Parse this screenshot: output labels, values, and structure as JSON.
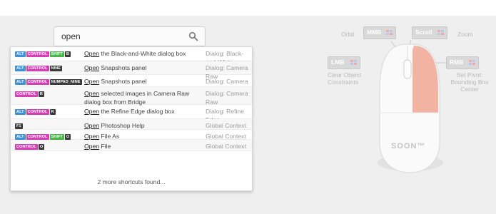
{
  "search": {
    "value": "open",
    "icon": "search-icon"
  },
  "results": [
    {
      "keys": [
        {
          "label": "ALT",
          "type": "alt"
        },
        {
          "label": "CONTROL",
          "type": "control"
        },
        {
          "label": "SHIFT",
          "type": "shift"
        },
        {
          "label": "B",
          "type": "plain"
        }
      ],
      "highlight": "Open",
      "text": " the Black-and-White dialog box",
      "context": "Dialog: Black-and-White"
    },
    {
      "keys": [
        {
          "label": "ALT",
          "type": "alt"
        },
        {
          "label": "CONTROL",
          "type": "control"
        },
        {
          "label": "NINE",
          "type": "plain"
        }
      ],
      "highlight": "Open",
      "text": " Snapshots panel",
      "context": "Dialog: Camera Raw"
    },
    {
      "keys": [
        {
          "label": "ALT",
          "type": "alt"
        },
        {
          "label": "CONTROL",
          "type": "control"
        },
        {
          "label": "NUMPAD_NINE",
          "type": "plain"
        }
      ],
      "highlight": "Open",
      "text": " Snapshots panel",
      "context": "Dialog: Camera Raw"
    },
    {
      "keys": [
        {
          "label": "CONTROL",
          "type": "control"
        },
        {
          "label": "R",
          "type": "plain"
        }
      ],
      "highlight": "Open",
      "text": " selected images in Camera Raw dialog box from Bridge",
      "context": "Dialog: Camera Raw"
    },
    {
      "keys": [
        {
          "label": "ALT",
          "type": "alt"
        },
        {
          "label": "CONTROL",
          "type": "control"
        },
        {
          "label": "R",
          "type": "plain"
        }
      ],
      "highlight": "Open",
      "text": " the Refine Edge dialog box",
      "context": "Dialog: Refine Edge"
    },
    {
      "keys": [
        {
          "label": "F1",
          "type": "plain"
        }
      ],
      "highlight": "Open",
      "text": " Photoshop Help",
      "context": "Global Context"
    },
    {
      "keys": [
        {
          "label": "ALT",
          "type": "alt"
        },
        {
          "label": "CONTROL",
          "type": "control"
        },
        {
          "label": "SHIFT",
          "type": "shift"
        },
        {
          "label": "O",
          "type": "plain"
        }
      ],
      "highlight": "Open",
      "text": " File As",
      "context": "Global Context"
    },
    {
      "keys": [
        {
          "label": "CONTROL",
          "type": "control"
        },
        {
          "label": "O",
          "type": "plain"
        }
      ],
      "highlight": "Open",
      "text": " File",
      "context": "Global Context"
    }
  ],
  "more_text": "2 more shortcuts found...",
  "mouse": {
    "orbit_label": "Orbit",
    "mmb": "MMB",
    "scroll": "Scroll",
    "zoom_label": "Zoom",
    "lmb": "LMB",
    "lmb_desc": "Clear Object Constraints",
    "rmb": "RMB",
    "rmb_desc": "Set Pivot: Bounding Box Center",
    "soon": "SOON™",
    "highlight_color": "#f2b3a3"
  }
}
